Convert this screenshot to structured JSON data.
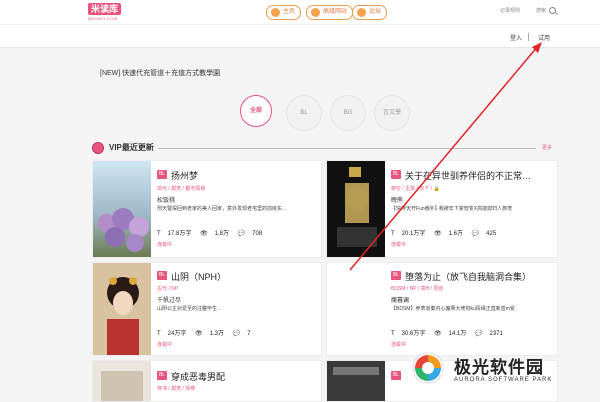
{
  "header": {
    "logo_text": "米读库",
    "logo_sub": "MIDUKU.COM",
    "nav": [
      {
        "label": "主页"
      },
      {
        "label": "高级网站"
      },
      {
        "label": "论坛"
      }
    ],
    "right_link": "记录规则",
    "search_label": "搜索"
  },
  "userbar": {
    "login": "登入",
    "trial": "试用"
  },
  "notice": "[NEW] 快速代充管道＋充值方式教學園",
  "categories": [
    {
      "label": "全部",
      "active": true
    },
    {
      "label": "BL"
    },
    {
      "label": "BG"
    },
    {
      "label": "言文學"
    }
  ],
  "section": {
    "title": "VIP最近更新",
    "more": "更多"
  },
  "books": [
    {
      "badge": "BL",
      "title": "扬州梦",
      "tags": "现代 / 甜宠 / 都市情缘",
      "author": "松饭桃",
      "desc": "刑天警探回到老家的美人回家，意外发现老宅里的前房东…",
      "words": "17.8万字",
      "views": "1.8万",
      "comments": "708",
      "status": "连载中"
    },
    {
      "badge": "BL",
      "title": "关于在异世驯养伴侣的不正常…",
      "tags": "架空 / 主奴 / 年下 / 🔒",
      "author": "晚熊",
      "desc": "【快穿天开Fun番外】·我被年下掌管变X高能媳妇人族宠",
      "words": "20.1万字",
      "views": "1.6万",
      "comments": "425",
      "status": "连载中"
    },
    {
      "badge": "BL",
      "title": "山阴（NPH）",
      "tags": "古代 / NP",
      "author": "千帆过尽",
      "desc": "山阴公主对爱至的注腹毕生…",
      "words": "24万字",
      "views": "1.3万",
      "comments": "7",
      "status": "连载中"
    },
    {
      "badge": "BL",
      "title": "堕落为止（放飞自我脑洞合集）",
      "tags": "BDSM / NP / 高H / 原创",
      "author": "魔暮谰",
      "desc": "【BDSM】养表道秦内心魔果大佬刻ku情缘正直新蓝m受",
      "words": "30.6万字",
      "views": "14.1万",
      "comments": "2371",
      "status": "连载中"
    },
    {
      "badge": "BL",
      "title": "穿成恶毒男配",
      "tags": "穿书 / 甜宠 / 快穿",
      "author": "",
      "desc": "",
      "words": "",
      "views": "",
      "comments": "",
      "status": ""
    },
    {
      "badge": "BL",
      "title": "",
      "tags": "",
      "author": "",
      "desc": "",
      "words": "",
      "views": "",
      "comments": "",
      "status": ""
    }
  ],
  "watermark": {
    "cn": "极光软件园",
    "en": "AURORA SOFTWARE PARK"
  },
  "colors": {
    "accent": "#e8547d",
    "nav_orange": "#e47b3a",
    "arrow": "#e0242a"
  }
}
